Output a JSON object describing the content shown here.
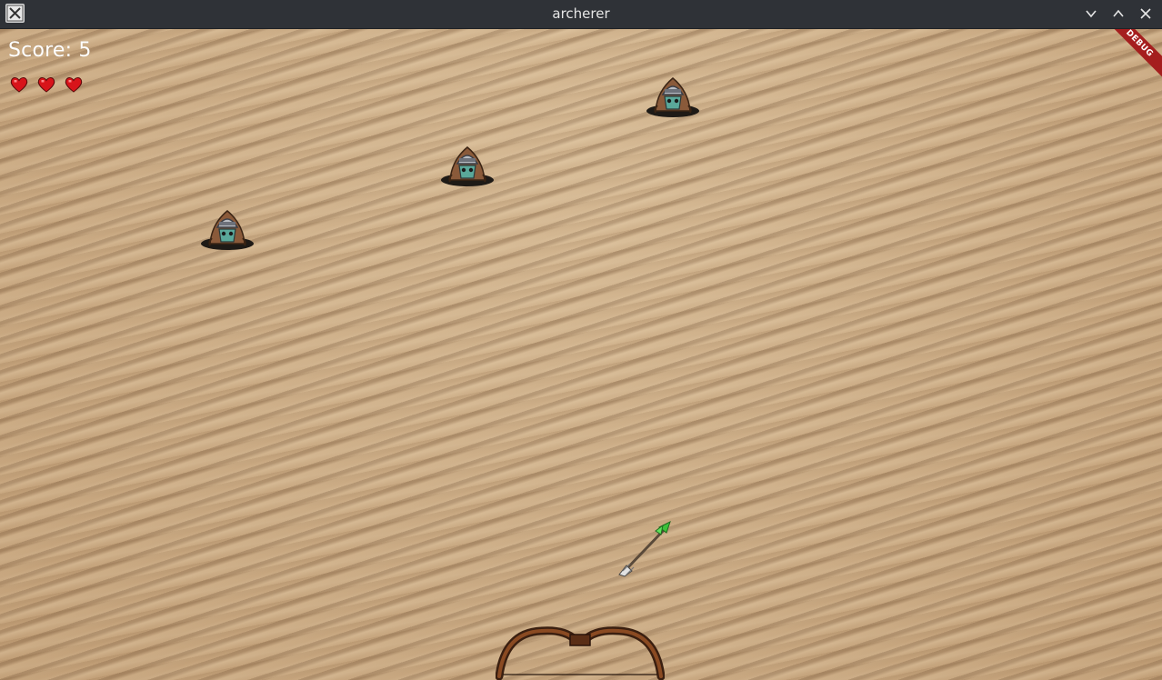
{
  "window": {
    "title": "archerer",
    "controls": [
      "minimize",
      "maximize",
      "close"
    ]
  },
  "hud": {
    "score_label": "Score: 5",
    "score": 5,
    "lives": 3,
    "heart_color": "#d8141a"
  },
  "debug_banner": "DEBUG",
  "enemies": [
    {
      "name": "enemy-1"
    },
    {
      "name": "enemy-2"
    },
    {
      "name": "enemy-3"
    }
  ],
  "colors": {
    "sand": "#c9a880",
    "titlebar": "#2f3237",
    "debug_ribbon": "#a51e1e",
    "arrow_fletching": "#3cc13a"
  },
  "icons": {
    "app": "app-icon",
    "minimize": "chevron-down-icon",
    "maximize": "chevron-up-icon",
    "close": "close-icon",
    "life": "heart-icon"
  }
}
